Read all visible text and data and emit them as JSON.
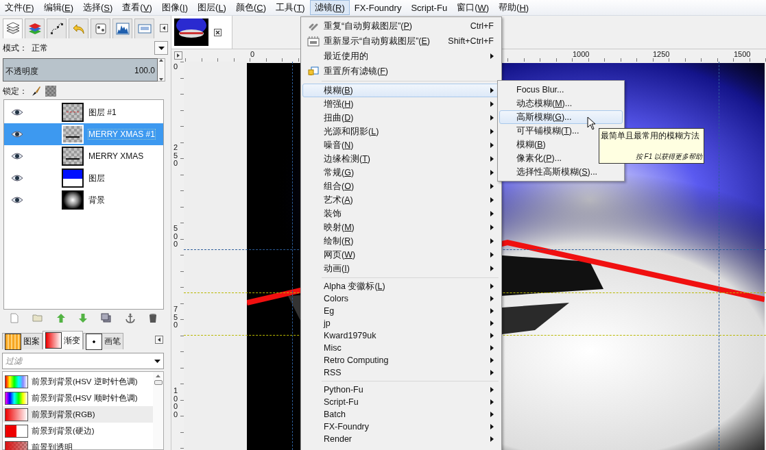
{
  "menubar": [
    {
      "label": "文件(F)",
      "selected": false
    },
    {
      "label": "编辑(E)",
      "selected": false
    },
    {
      "label": "选择(S)",
      "selected": false
    },
    {
      "label": "查看(V)",
      "selected": false
    },
    {
      "label": "图像(I)",
      "selected": false
    },
    {
      "label": "图层(L)",
      "selected": false
    },
    {
      "label": "颜色(C)",
      "selected": false
    },
    {
      "label": "工具(T)",
      "selected": false
    },
    {
      "label": "滤镜(R)",
      "selected": true
    },
    {
      "label": "FX-Foundry",
      "selected": false
    },
    {
      "label": "Script-Fu",
      "selected": false
    },
    {
      "label": "窗口(W)",
      "selected": false
    },
    {
      "label": "帮助(H)",
      "selected": false
    }
  ],
  "dock_tabs": [
    {
      "kind": "layers",
      "selected": true
    },
    {
      "kind": "channels",
      "selected": false
    },
    {
      "kind": "paths",
      "selected": false
    },
    {
      "kind": "undo",
      "selected": false
    },
    {
      "kind": "pointer",
      "selected": false
    },
    {
      "kind": "histogram",
      "selected": false
    },
    {
      "kind": "navigation",
      "selected": false
    }
  ],
  "layers_panel": {
    "mode_label": "模式：",
    "mode_value": "正常",
    "opacity_label": "不透明度",
    "opacity_value": "100.0",
    "opacity": {
      "level": 1.0
    },
    "lock_label": "锁定：",
    "layers": [
      {
        "name": "图层 #1",
        "visible": true,
        "selected": false,
        "kind": "checker-red"
      },
      {
        "name": "MERRY XMAS #1",
        "visible": true,
        "selected": true,
        "kind": "checker-text"
      },
      {
        "name": "MERRY XMAS",
        "visible": true,
        "selected": false,
        "kind": "checker-text"
      },
      {
        "name": "图层",
        "visible": true,
        "selected": false,
        "kind": "blue"
      },
      {
        "name": "背景",
        "visible": true,
        "selected": false,
        "kind": "radial"
      }
    ]
  },
  "resource_tabs": [
    {
      "label": "图案",
      "kind": "pattern",
      "selected": false
    },
    {
      "label": "渐变",
      "kind": "gradient",
      "selected": true
    },
    {
      "label": "画笔",
      "kind": "brush",
      "selected": false
    }
  ],
  "gradient_filter": {
    "placeholder": "过滤"
  },
  "gradients": [
    {
      "name": "前景到背景(HSV 逆时针色调)",
      "kind": "hsv-ccw",
      "selected": false
    },
    {
      "name": "前景到背景(HSV 顺时针色调)",
      "kind": "hsv-cw",
      "selected": false
    },
    {
      "name": "前景到背景(RGB)",
      "kind": "rgb",
      "selected": true
    },
    {
      "name": "前景到背景(硬边)",
      "kind": "hard",
      "selected": false
    },
    {
      "name": "前景到透明",
      "kind": "transparent",
      "selected": false
    }
  ],
  "rulers": {
    "horizontal": [
      "0",
      "1000",
      "1250",
      "1500"
    ],
    "vertical": [
      "0",
      "250",
      "500",
      "750",
      "1000"
    ]
  },
  "filter_menu": {
    "sections": [
      {
        "items": [
          {
            "label": "重复“自动剪裁图层”(P)",
            "shortcut": "Ctrl+F",
            "kind": "repeat",
            "selected": false
          },
          {
            "label": "重新显示“自动剪裁图层”(E)",
            "shortcut": "Shift+Ctrl+F",
            "kind": "reshow",
            "selected": false
          },
          {
            "label": "最近使用的",
            "kind": "submenu",
            "selected": false
          },
          {
            "label": "重置所有滤镜(F)",
            "kind": "reset",
            "selected": false
          }
        ]
      },
      {
        "items": [
          {
            "label": "模糊(B)",
            "kind": "submenu",
            "selected": true
          },
          {
            "label": "增强(H)",
            "kind": "submenu",
            "selected": false
          },
          {
            "label": "扭曲(D)",
            "kind": "submenu",
            "selected": false
          },
          {
            "label": "光源和阴影(L)",
            "kind": "submenu",
            "selected": false
          },
          {
            "label": "噪音(N)",
            "kind": "submenu",
            "selected": false
          },
          {
            "label": "边缘检测(T)",
            "kind": "submenu",
            "selected": false
          },
          {
            "label": "常规(G)",
            "kind": "submenu",
            "selected": false
          },
          {
            "label": "组合(O)",
            "kind": "submenu",
            "selected": false
          },
          {
            "label": "艺术(A)",
            "kind": "submenu",
            "selected": false
          },
          {
            "label": "装饰",
            "kind": "submenu",
            "selected": false
          },
          {
            "label": "映射(M)",
            "kind": "submenu",
            "selected": false
          },
          {
            "label": "绘制(R)",
            "kind": "submenu",
            "selected": false
          },
          {
            "label": "网页(W)",
            "kind": "submenu",
            "selected": false
          },
          {
            "label": "动画(I)",
            "kind": "submenu",
            "selected": false
          }
        ]
      },
      {
        "items": [
          {
            "label": "Alpha 变徽标(L)",
            "kind": "submenu",
            "selected": false
          },
          {
            "label": "Colors",
            "kind": "submenu",
            "selected": false
          },
          {
            "label": "Eg",
            "kind": "submenu",
            "selected": false
          },
          {
            "label": "jp",
            "kind": "submenu",
            "selected": false
          },
          {
            "label": "Kward1979uk",
            "kind": "submenu",
            "selected": false
          },
          {
            "label": "Misc",
            "kind": "submenu",
            "selected": false
          },
          {
            "label": "Retro Computing",
            "kind": "submenu",
            "selected": false
          },
          {
            "label": "RSS",
            "kind": "submenu",
            "selected": false
          }
        ]
      },
      {
        "items": [
          {
            "label": "Python-Fu",
            "kind": "submenu",
            "selected": false
          },
          {
            "label": "Script-Fu",
            "kind": "submenu",
            "selected": false
          },
          {
            "label": "Batch",
            "kind": "submenu",
            "selected": false
          },
          {
            "label": "FX-Foundry",
            "kind": "submenu",
            "selected": false
          },
          {
            "label": "Render",
            "kind": "submenu",
            "selected": false
          }
        ]
      }
    ]
  },
  "blur_submenu": [
    {
      "label": "Focus Blur...",
      "selected": false
    },
    {
      "label": "动态模糊(M)...",
      "selected": false
    },
    {
      "label": "高斯模糊(G)...",
      "selected": true
    },
    {
      "label": "可平铺模糊(T)...",
      "selected": false
    },
    {
      "label": "模糊(B)",
      "selected": false
    },
    {
      "label": "像素化(P)...",
      "selected": false
    },
    {
      "label": "选择性高斯模糊(S)...",
      "selected": false
    }
  ],
  "tooltip": {
    "text": "最简单且最常用的模糊方法",
    "hint": "按 F1 以获得更多帮助"
  }
}
